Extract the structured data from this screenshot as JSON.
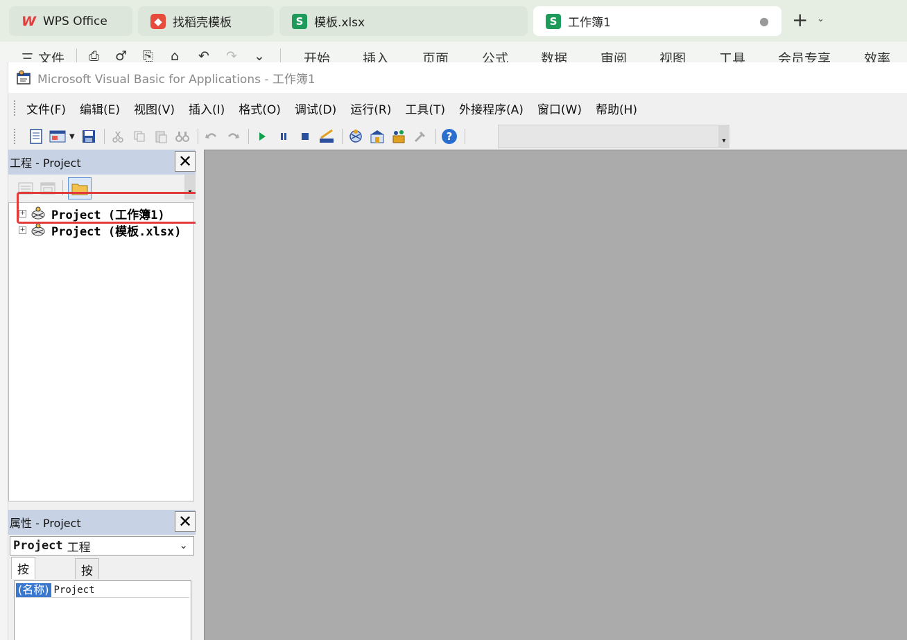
{
  "tabs": [
    {
      "label": "WPS Office",
      "icon": "wps-logo-icon"
    },
    {
      "label": "找稻壳模板",
      "icon": "docer-icon"
    },
    {
      "label": "模板.xlsx",
      "icon": "spreadsheet-icon"
    },
    {
      "label": "工作簿1",
      "icon": "spreadsheet-icon",
      "active": true,
      "status": "●"
    }
  ],
  "newtab": {
    "plus": "+",
    "arrow": "⌄"
  },
  "ribbon": {
    "file": "三 文件",
    "quick_icons": [
      "⎙",
      "♂",
      "⎘",
      "⌂",
      "↶",
      "↷",
      "⌄"
    ],
    "items": [
      "开始",
      "插入",
      "页面",
      "公式",
      "数据",
      "审阅",
      "视图",
      "工具",
      "会员专享",
      "效率"
    ]
  },
  "vba": {
    "title": "Microsoft Visual Basic for Applications - 工作簿1",
    "menu": [
      "文件(F)",
      "编辑(E)",
      "视图(V)",
      "插入(I)",
      "格式(O)",
      "调试(D)",
      "运行(R)",
      "工具(T)",
      "外接程序(A)",
      "窗口(W)",
      "帮助(H)"
    ],
    "project_pane": {
      "title": "工程 - Project",
      "close": "✕",
      "items": [
        "Project (工作簿1)",
        "Project (模板.xlsx)"
      ],
      "expander": "+"
    },
    "properties_pane": {
      "title": "属性 - Project",
      "close": "✕",
      "object_name": "Project",
      "object_type": "工程",
      "chevron": "⌄",
      "tabs": [
        "按字母序",
        "按分类序"
      ],
      "rows": [
        {
          "key": "(名称)",
          "value": "Project"
        }
      ]
    }
  },
  "colors": {
    "highlight": "#e23b3b",
    "workspace": "#ababab",
    "pane_header": "#c7d3e4",
    "selected_key": "#3a78d0"
  }
}
